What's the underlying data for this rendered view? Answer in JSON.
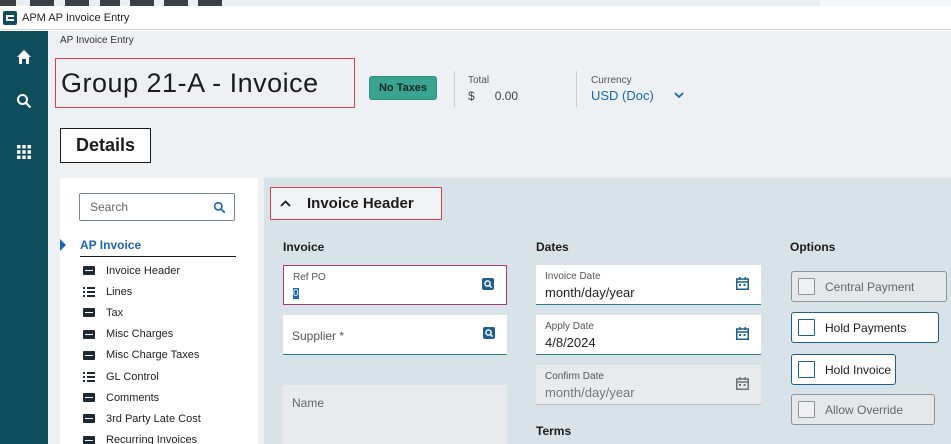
{
  "window": {
    "title": "APM AP Invoice Entry"
  },
  "nav": {
    "items": [
      {
        "name": "home-icon"
      },
      {
        "name": "search-icon"
      },
      {
        "name": "grid-menu-icon"
      }
    ]
  },
  "breadcrumb": "AP Invoice Entry",
  "header": {
    "title": "Group 21-A - Invoice",
    "tax_badge": "No Taxes",
    "total_label": "Total",
    "total_currency_symbol": "$",
    "total_value": "0.00",
    "currency_label": "Currency",
    "currency_value": "USD (Doc)"
  },
  "tabs": {
    "details": "Details"
  },
  "sidebar": {
    "search_placeholder": "Search",
    "root": "AP Invoice",
    "items": [
      {
        "label": "Invoice Header",
        "icon": "card-icon"
      },
      {
        "label": "Lines",
        "icon": "list-icon"
      },
      {
        "label": "Tax",
        "icon": "card-icon"
      },
      {
        "label": "Misc Charges",
        "icon": "card-icon"
      },
      {
        "label": "Misc Charge Taxes",
        "icon": "card-icon"
      },
      {
        "label": "GL Control",
        "icon": "list-icon"
      },
      {
        "label": "Comments",
        "icon": "card-icon"
      },
      {
        "label": "3rd Party Late Cost",
        "icon": "card-icon"
      },
      {
        "label": "Recurring Invoices",
        "icon": "card-icon"
      }
    ]
  },
  "section": {
    "title": "Invoice Header",
    "invoice_col": "Invoice",
    "dates_col": "Dates",
    "options_col": "Options",
    "ref_po_label": "Ref PO",
    "ref_po_value": "0",
    "supplier_placeholder": "Supplier *",
    "name_placeholder": "Name",
    "invoice_date_label": "Invoice Date",
    "invoice_date_value": "month/day/year",
    "apply_date_label": "Apply Date",
    "apply_date_value": "4/8/2024",
    "confirm_date_label": "Confirm Date",
    "confirm_date_value": "month/day/year",
    "terms_label": "Terms",
    "options": {
      "central_payment": "Central Payment",
      "hold_payments": "Hold Payments",
      "hold_invoice": "Hold Invoice",
      "allow_override": "Allow Override"
    }
  },
  "colors": {
    "nav_bg": "#0e4d5c",
    "accent_blue": "#1a66b5",
    "badge_green": "#3aa392",
    "highlight_red": "#e0404a",
    "panel_bg": "#d7e3e8"
  }
}
